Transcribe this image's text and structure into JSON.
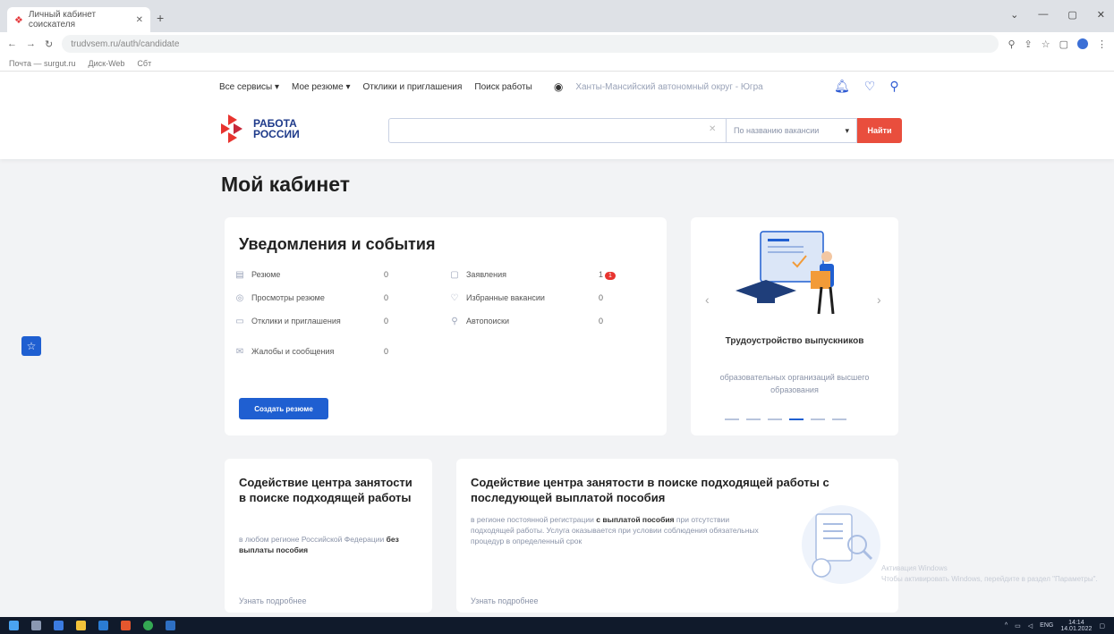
{
  "browser": {
    "tab_title": "Личный кабинет соискателя",
    "url": "trudvsem.ru/auth/candidate",
    "bookmarks": [
      "Почта — surgut.ru",
      "Диск-Web",
      "Сбт"
    ]
  },
  "header": {
    "nav": [
      "Все сервисы",
      "Мое резюме",
      "Отклики и приглашения",
      "Поиск работы"
    ],
    "region": "Ханты-Мансийский автономный округ - Югра",
    "logo_line1": "РАБОТА",
    "logo_line2": "РОССИИ",
    "search_select": "По названию вакансии",
    "search_button": "Найти"
  },
  "page": {
    "title": "Мой кабинет"
  },
  "notifications": {
    "title": "Уведомления и события",
    "left": [
      {
        "label": "Резюме",
        "count": "0"
      },
      {
        "label": "Просмотры резюме",
        "count": "0"
      },
      {
        "label": "Отклики и приглашения",
        "count": "0"
      },
      {
        "label": "Жалобы и сообщения",
        "count": "0"
      }
    ],
    "right": [
      {
        "label": "Заявления",
        "count": "1",
        "badge": "1"
      },
      {
        "label": "Избранные вакансии",
        "count": "0"
      },
      {
        "label": "Автопоиски",
        "count": "0"
      }
    ],
    "create_button": "Создать резюме"
  },
  "slider": {
    "title": "Трудоустройство выпускников",
    "desc": "образовательных организаций высшего образования",
    "dots": 6,
    "active_dot": 3
  },
  "service_a": {
    "title": "Содействие центра занятости в поиске подходящей работы",
    "desc_pre": "в любом регионе Российской Федерации",
    "desc_bold": "без выплаты пособия",
    "more": "Узнать подробнее"
  },
  "service_b": {
    "title": "Содействие центра занятости в поиске подходящей работы с последующей выплатой пособия",
    "desc_pre": "в регионе постоянной регистрации",
    "desc_bold": "с выплатой пособия",
    "desc_post": "при отсутствии подходящей работы. Услуга оказывается при условии соблюдения обязательных процедур в определенный срок",
    "more": "Узнать подробнее"
  },
  "watermark": {
    "line1": "Активация Windows",
    "line2": "Чтобы активировать Windows, перейдите в раздел \"Параметры\"."
  },
  "taskbar": {
    "lang": "ENG",
    "time": "14:14",
    "date": "14.01.2022"
  },
  "colors": {
    "accent_blue": "#1f5fd1",
    "brand_red": "#e94e3d",
    "text_muted": "#8a93a8"
  }
}
